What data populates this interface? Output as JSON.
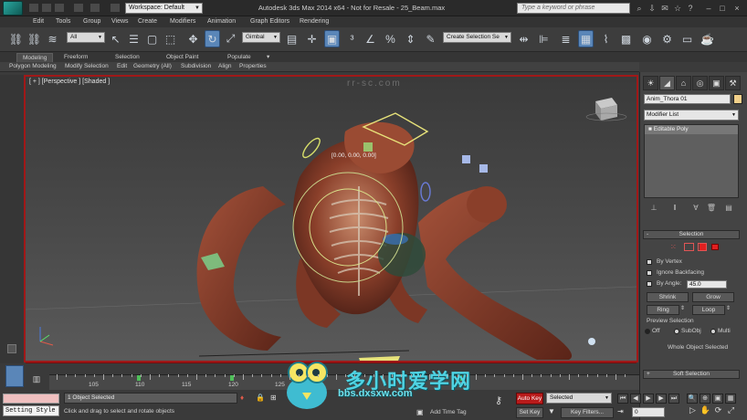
{
  "title_bar": {
    "title": "Autodesk 3ds Max 2014 x64 - Not for Resale - 25_Beam.max",
    "workspace": "Workspace: Default",
    "search_placeholder": "Type a keyword or phrase"
  },
  "menu": [
    "Edit",
    "Tools",
    "Group",
    "Views",
    "Create",
    "Modifiers",
    "Animation",
    "Graph Editors",
    "Rendering"
  ],
  "toolbar": {
    "filter_value": "All",
    "ref_coord_value": "Gimbal",
    "named_selection_value": "Create Selection Se"
  },
  "ribbon": {
    "tabs": [
      "Modeling",
      "Freeform",
      "Selection",
      "Object Paint",
      "Populate"
    ],
    "subtabs": [
      "Polygon Modeling",
      "Modify Selection",
      "Edit",
      "Geometry (All)",
      "Subdivision",
      "Align",
      "Properties"
    ]
  },
  "viewport": {
    "label": "[ + ] [Perspective ] [Shaded ]",
    "coord_readout": "[0.00, 0.00, 0.00]",
    "watermark": "rr-sc.com"
  },
  "command_panel": {
    "object_name": "Anim_Thora 01",
    "modifier_list": "Modifier List",
    "stack_item": "Editable Poly",
    "selection_rollout": "Selection",
    "by_vertex": "By Vertex",
    "ignore_backfacing": "Ignore Backfacing",
    "by_angle": "By Angle:",
    "by_angle_value": "45.0",
    "shrink": "Shrink",
    "grow": "Grow",
    "ring": "Ring",
    "loop": "Loop",
    "preview_selection": "Preview Selection",
    "off": "Off",
    "subobj": "SubObj",
    "multi": "Multi",
    "whole_object": "Whole Object Selected",
    "soft_selection": "Soft Selection"
  },
  "timeline": {
    "labels": [
      "100",
      "105",
      "110",
      "115",
      "120",
      "125",
      "130",
      "135",
      "140",
      "145",
      "150"
    ],
    "current_frame": "0"
  },
  "status": {
    "selected_text": "1 Object Selected",
    "prompt": "Click and drag to select and rotate objects",
    "setting_style": "Setting Style",
    "add_time_tag": "Add Time Tag",
    "auto_key": "Auto Key",
    "set_key": "Set Key",
    "selected_dd": "Selected",
    "key_filters": "Key Filters..."
  },
  "watermark": {
    "brand": "多小时爱学网",
    "url": "bbs.dxsxw.com"
  },
  "colors": {
    "active_border": "#a01818",
    "auto_key": "#b81a1a",
    "selection_blue": "#5a86b8",
    "watermark": "#4fd3e3",
    "color_swatch": "#f2d08a"
  }
}
